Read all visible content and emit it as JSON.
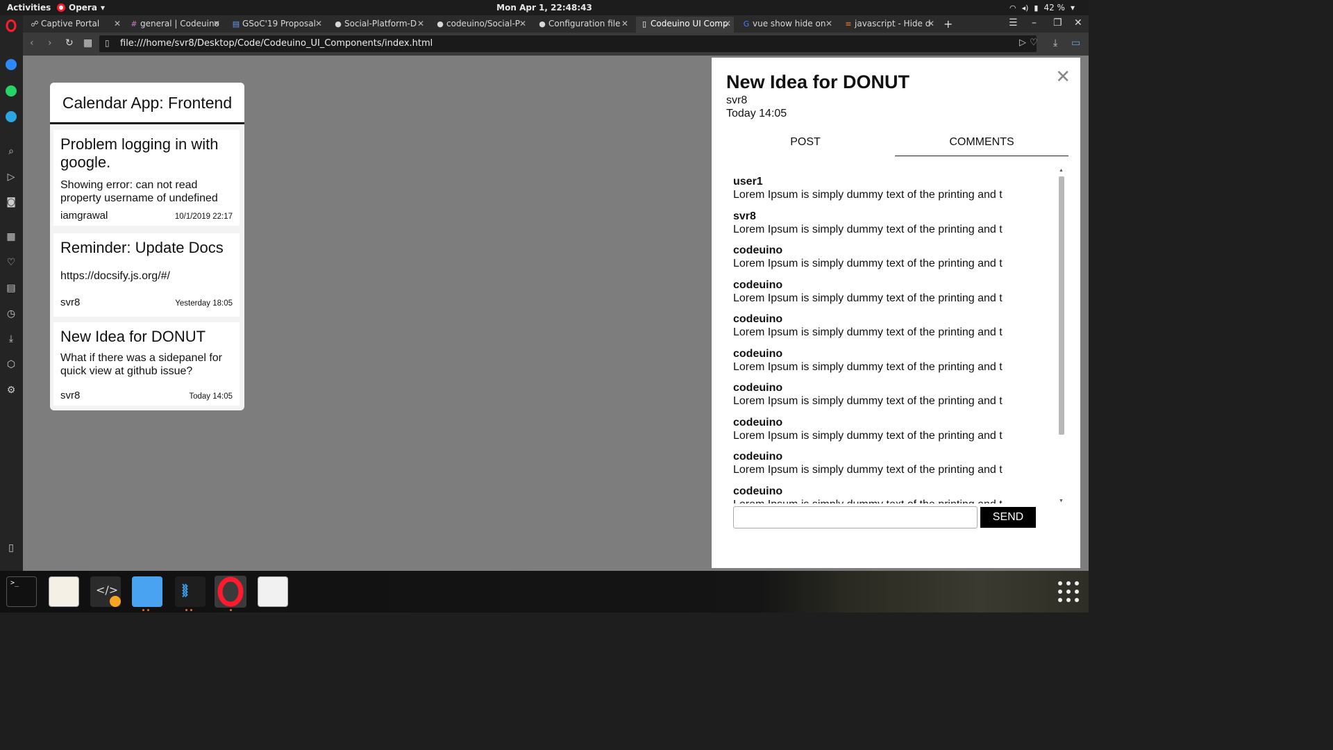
{
  "topbar": {
    "activities": "Activities",
    "app_name": "Opera",
    "clock": "Mon Apr  1, 22:48:43",
    "battery": "42 %"
  },
  "tabs": [
    {
      "title": "Captive Portal",
      "icon": "globe-icon"
    },
    {
      "title": "general | Codeuino",
      "icon": "slack-icon"
    },
    {
      "title": "GSoC'19 Proposal",
      "icon": "docs-icon"
    },
    {
      "title": "Social-Platform-D",
      "icon": "github-icon"
    },
    {
      "title": "codeuino/Social-P",
      "icon": "github-icon"
    },
    {
      "title": "Configuration file",
      "icon": "github-icon"
    },
    {
      "title": "Codeuino UI Comp",
      "icon": "file-icon"
    },
    {
      "title": "vue show hide on",
      "icon": "google-icon"
    },
    {
      "title": "javascript - Hide d",
      "icon": "stackoverflow-icon"
    }
  ],
  "address_bar": {
    "url": "file:///home/svr8/Desktop/Code/Codeuino_UI_Components/index.html"
  },
  "board": {
    "title": "Calendar App: Frontend",
    "cards": [
      {
        "title": "Problem logging in with google.",
        "body": "Showing error: can not read property username of undefined",
        "user": "iamgrawal",
        "date": "10/1/2019 22:17"
      },
      {
        "title": "Reminder: Update Docs",
        "body": "https://docsify.js.org/#/",
        "user": "svr8",
        "date": "Yesterday 18:05"
      },
      {
        "title": "New Idea for DONUT",
        "body": "What if there was a sidepanel for quick view at github issue?",
        "user": "svr8",
        "date": "Today 14:05"
      }
    ]
  },
  "panel": {
    "title": "New Idea for DONUT",
    "author": "svr8",
    "date": "Today 14:05",
    "tabs": [
      "POST",
      "COMMENTS"
    ],
    "active_tab": "COMMENTS",
    "comments": [
      {
        "user": "user1",
        "text": "Lorem Ipsum is simply dummy text of the printing and t"
      },
      {
        "user": "svr8",
        "text": "Lorem Ipsum is simply dummy text of the printing and t"
      },
      {
        "user": "codeuino",
        "text": "Lorem Ipsum is simply dummy text of the printing and t"
      },
      {
        "user": "codeuino",
        "text": "Lorem Ipsum is simply dummy text of the printing and t"
      },
      {
        "user": "codeuino",
        "text": "Lorem Ipsum is simply dummy text of the printing and t"
      },
      {
        "user": "codeuino",
        "text": "Lorem Ipsum is simply dummy text of the printing and t"
      },
      {
        "user": "codeuino",
        "text": "Lorem Ipsum is simply dummy text of the printing and t"
      },
      {
        "user": "codeuino",
        "text": "Lorem Ipsum is simply dummy text of the printing and t"
      },
      {
        "user": "codeuino",
        "text": "Lorem Ipsum is simply dummy text of the printing and t"
      },
      {
        "user": "codeuino",
        "text": "Lorem Ipsum is simply dummy text of the printing and t"
      }
    ],
    "comment_input_value": "",
    "send_label": "SEND"
  },
  "colors": {
    "content_bg": "#7d7d7d",
    "opera_red": "#ff1b2d",
    "send_bg": "#000000"
  }
}
